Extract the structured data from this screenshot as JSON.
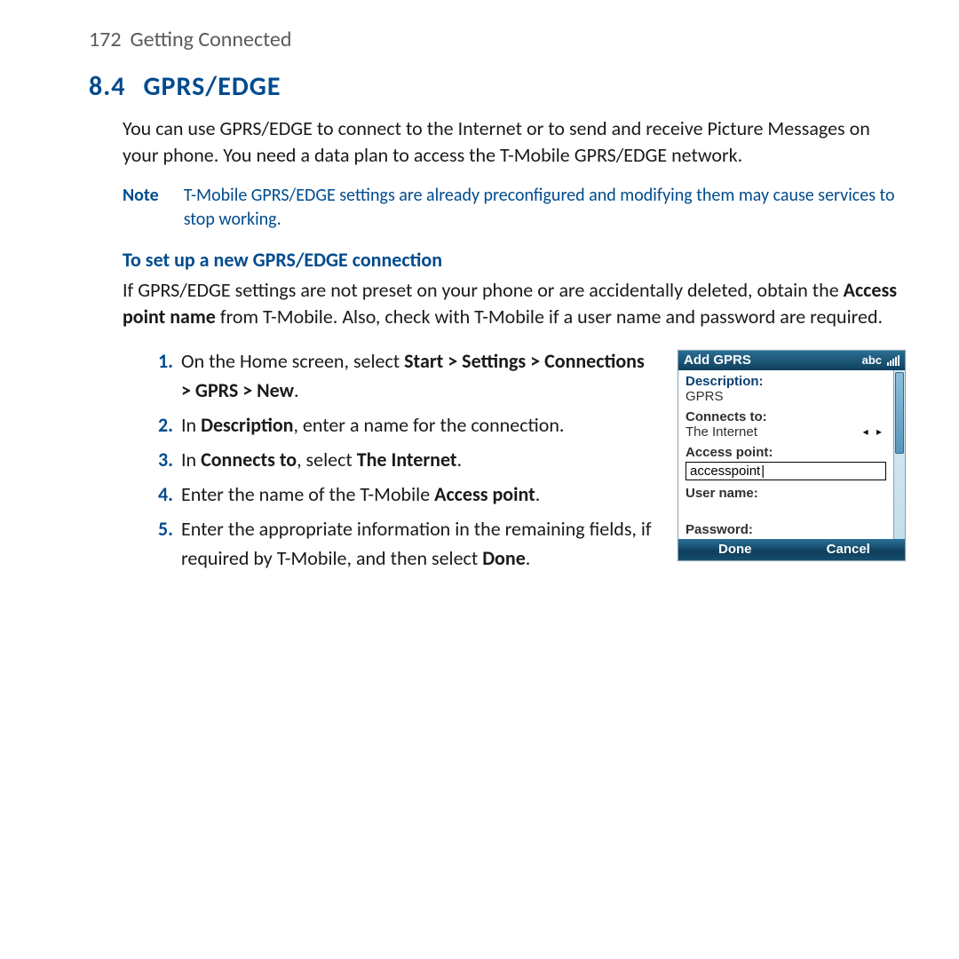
{
  "header": {
    "page_num": "172",
    "chapter": "Getting Connected"
  },
  "heading": {
    "num": "8.4",
    "title": "GPRS/EDGE"
  },
  "intro": "You can use GPRS/EDGE to connect to the Internet or to send and receive Picture Messages on your phone. You need a data plan to access the T-Mobile GPRS/EDGE network.",
  "note": {
    "label": "Note",
    "text": "T-Mobile GPRS/EDGE settings are already preconfigured and modifying them may cause services to stop working."
  },
  "subheading": "To set up a new GPRS/EDGE connection",
  "setup_intro": {
    "pre": "If GPRS/EDGE settings are not preset on your phone or are accidentally deleted, obtain the ",
    "bold1": "Access point name",
    "post": " from T-Mobile. Also, check with T-Mobile if a user name and password are required."
  },
  "steps": [
    {
      "pre": "On the Home screen, select ",
      "b1": "Start > Settings > Connections > GPRS > New",
      "post": "."
    },
    {
      "pre": "In ",
      "b1": "Description",
      "mid": ", enter a name for the connection.",
      "post": ""
    },
    {
      "pre": "In ",
      "b1": "Connects to",
      "mid": ", select ",
      "b2": "The Internet",
      "post": "."
    },
    {
      "pre": "Enter the name of the T-Mobile ",
      "b1": "Access point",
      "post": "."
    },
    {
      "pre": "Enter the appropriate information in the remaining fields, if required by T-Mobile, and then select ",
      "b1": "Done",
      "post": "."
    }
  ],
  "phone": {
    "title": "Add GPRS",
    "input_mode": "abc",
    "fields": {
      "description_label": "Description:",
      "description_value": "GPRS",
      "connects_label": "Connects to:",
      "connects_value": "The Internet",
      "access_point_label": "Access point:",
      "access_point_value": "accesspoint",
      "username_label": "User name:",
      "username_value": "",
      "password_label": "Password:",
      "password_value": ""
    },
    "softkeys": {
      "left": "Done",
      "right": "Cancel"
    }
  }
}
